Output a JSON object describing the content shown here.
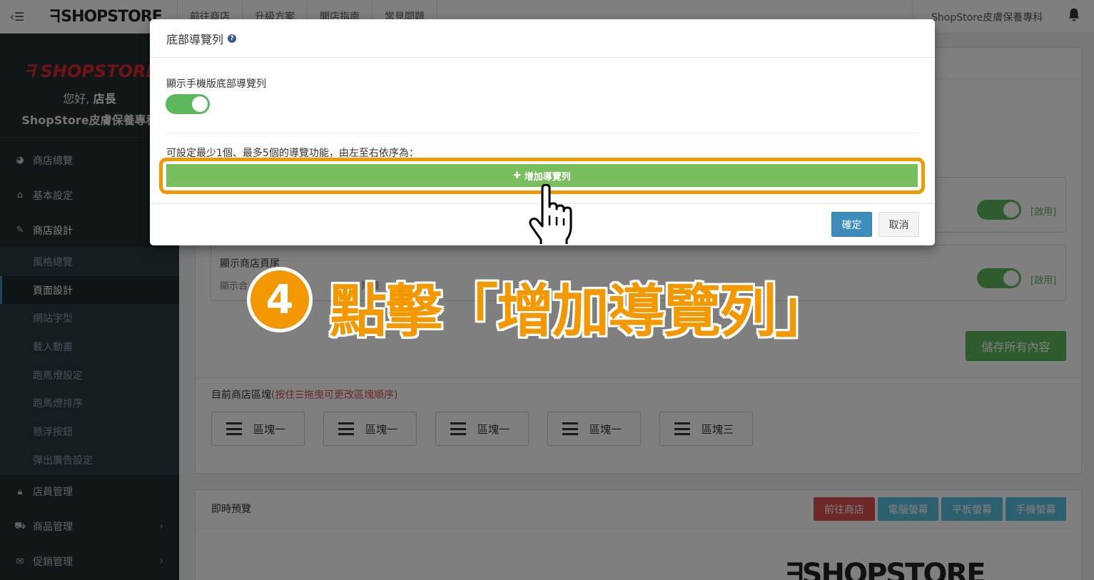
{
  "topbar": {
    "brand": "SHOPSTORE",
    "nav": [
      "前往商店",
      "升級方案",
      "開店指南",
      "常見問題"
    ],
    "shop_name": "ShopStore皮膚保養專科"
  },
  "sidebar": {
    "logo": "SHOPSTORE",
    "greeting": "您好,",
    "role": "店長",
    "shop_name": "ShopStore皮膚保養專科",
    "menu_top": [
      {
        "label": "商店總覽",
        "icon": "dashboard-icon"
      },
      {
        "label": "基本設定",
        "icon": "bank-icon"
      },
      {
        "label": "商店設計",
        "icon": "magic-wand-icon"
      }
    ],
    "submenu": [
      "風格總覽",
      "頁面設計",
      "網站字型",
      "載入動畫",
      "跑馬燈設定",
      "跑馬燈排序",
      "懸浮按鈕",
      "彈出廣告設定"
    ],
    "menu_bottom": [
      {
        "label": "店員管理",
        "icon": "lock-icon"
      },
      {
        "label": "商品管理",
        "icon": "cart-icon"
      },
      {
        "label": "促銷管理",
        "icon": "gift-icon"
      }
    ]
  },
  "settings": {
    "footer_title": "顯示商店頁尾",
    "footer_desc_left": "顯示合",
    "footer_desc_right": "尾資",
    "enabled_label": "[啟用]",
    "save_all": "儲存所有內容"
  },
  "blocks": {
    "title": "目前商店區塊",
    "hint": "(按住☰拖曳可更改區塊順序)",
    "items": [
      "區塊一",
      "區塊一",
      "區塊一",
      "區塊一",
      "區塊三"
    ]
  },
  "preview": {
    "title": "即時預覽",
    "buttons": [
      "前往商店",
      "電腦螢幕",
      "平板螢幕",
      "手機螢幕"
    ],
    "colors": [
      "#d9534f",
      "#5bc0de",
      "#5bc0de",
      "#5bc0de"
    ],
    "logo": "SHOPSTORE"
  },
  "modal": {
    "title": "底部導覽列",
    "toggle_label": "顯示手機版底部導覽列",
    "description": "可設定最少1個、最多5個的導覽功能，由左至右依序為：",
    "add_button": "增加導覽列",
    "confirm": "確定",
    "cancel": "取消"
  },
  "annotation": {
    "step": "4",
    "text": "點擊「增加導覽列」",
    "color": "#f39800"
  }
}
